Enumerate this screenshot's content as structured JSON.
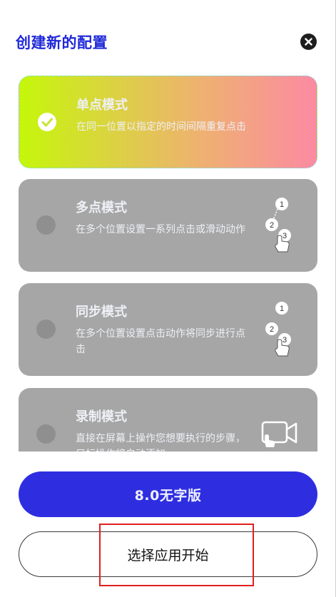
{
  "dialog": {
    "title": "创建新的配置",
    "close_icon": "close-icon"
  },
  "modes": [
    {
      "title": "单点模式",
      "description": "在同一位置以指定的时间间隔重复点击",
      "selected": true,
      "icon": "check-icon"
    },
    {
      "title": "多点模式",
      "description": "在多个位置设置一系列点击或滑动动作",
      "selected": false,
      "icon": "multi-tap-icon",
      "icon_digits": [
        "1",
        "2",
        "3"
      ]
    },
    {
      "title": "同步模式",
      "description": "在多个位置设置点击动作将同步进行点击",
      "selected": false,
      "icon": "sync-tap-icon",
      "icon_digits": [
        "1",
        "2",
        "3"
      ]
    },
    {
      "title": "录制模式",
      "description": "直接在屏幕上操作您想要执行的步骤，目标操作将自动添加",
      "selected": false,
      "icon": "record-screen-icon"
    }
  ],
  "buttons": {
    "primary_label": "8.0无字版",
    "secondary_label": "选择应用开始"
  },
  "colors": {
    "title": "#1f28d8",
    "primary_button": "#2e2ee0",
    "card_inactive": "#a6a6a6",
    "highlight": "#e0201d",
    "gradient": [
      "#c5f70a",
      "#efb072",
      "#fb8aa2"
    ]
  }
}
